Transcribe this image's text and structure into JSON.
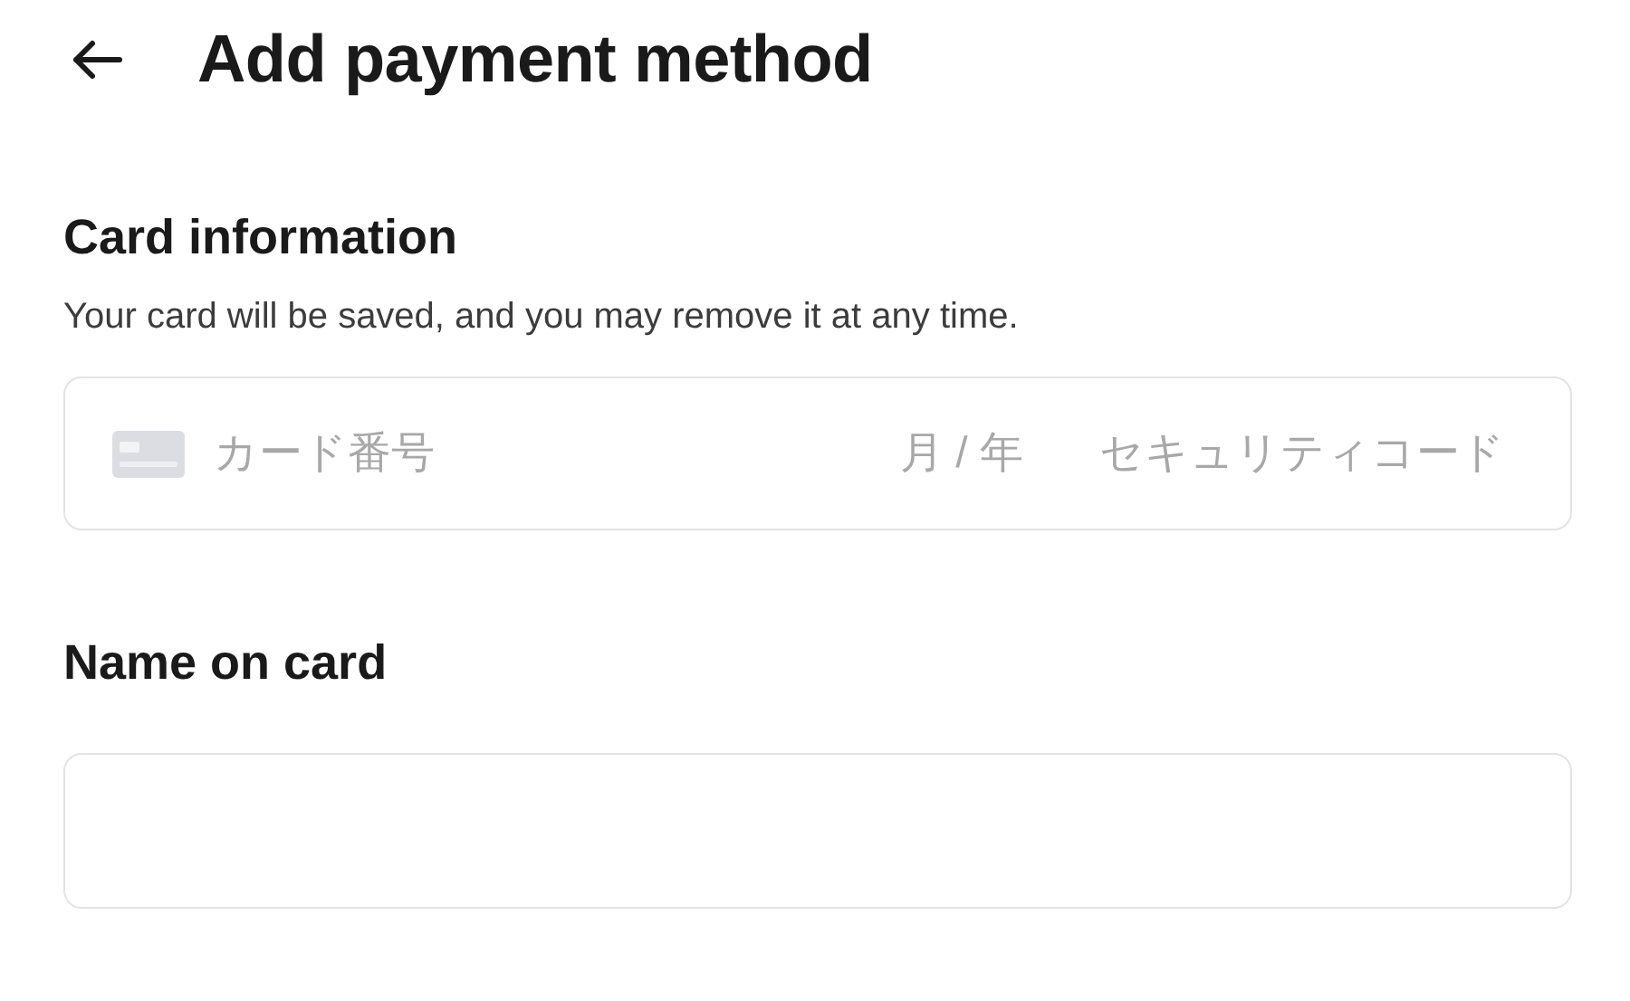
{
  "header": {
    "title": "Add payment method"
  },
  "card_section": {
    "heading": "Card information",
    "description": "Your card will be saved, and you may remove it at any time.",
    "card_field": {
      "number_placeholder": "カード番号",
      "expiry_placeholder": "月 / 年",
      "cvc_placeholder": "セキュリティコード"
    }
  },
  "name_section": {
    "heading": "Name on card"
  }
}
